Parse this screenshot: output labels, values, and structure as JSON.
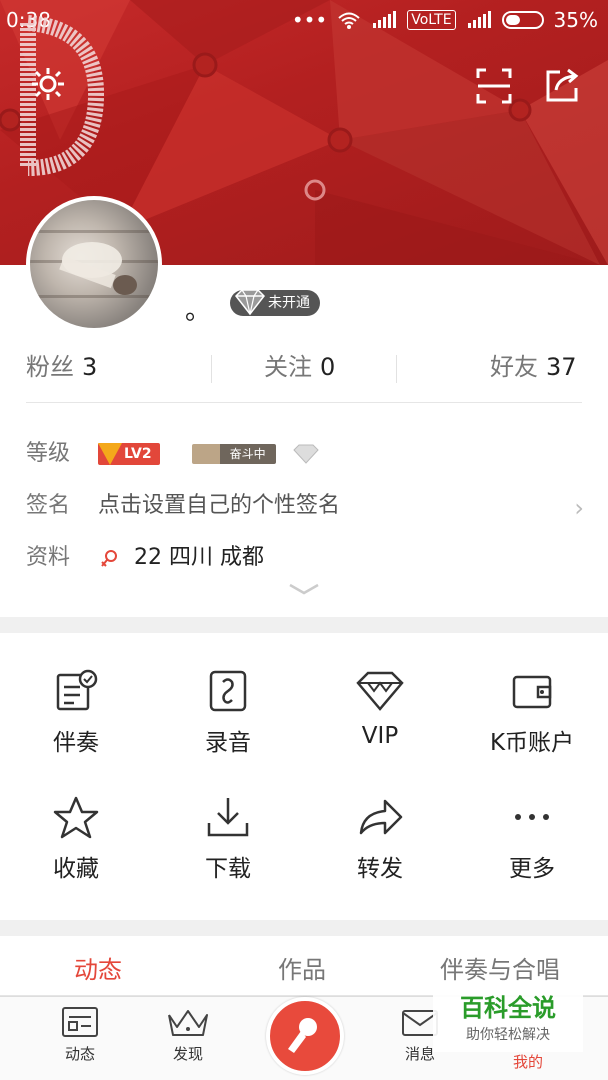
{
  "status_bar": {
    "time": "0:38",
    "network": "VoLTE",
    "battery": "35%"
  },
  "profile": {
    "nickname": "。",
    "vip_status": "未开通",
    "stats": [
      {
        "label": "粉丝",
        "value": "3"
      },
      {
        "label": "关注",
        "value": "0"
      },
      {
        "label": "好友",
        "value": "37"
      }
    ],
    "level_label": "等级",
    "level_badge": "LV2",
    "struggle_badge": "奋斗中",
    "signature_label": "签名",
    "signature_placeholder": "点击设置自己的个性签名",
    "info_label": "资料",
    "info_value": "22  四川 成都"
  },
  "menu": [
    {
      "label": "伴奏",
      "icon": "accompaniment-icon"
    },
    {
      "label": "录音",
      "icon": "record-audio-icon"
    },
    {
      "label": "VIP",
      "icon": "diamond-icon"
    },
    {
      "label": "K币账户",
      "icon": "wallet-icon"
    },
    {
      "label": "收藏",
      "icon": "star-icon"
    },
    {
      "label": "下载",
      "icon": "download-icon"
    },
    {
      "label": "转发",
      "icon": "forward-icon"
    },
    {
      "label": "更多",
      "icon": "more-icon"
    }
  ],
  "tabs": [
    "动态",
    "作品",
    "伴奏与合唱"
  ],
  "bottom_nav": [
    "动态",
    "发现",
    "消息",
    "我的"
  ],
  "watermark": {
    "title": "百科全说",
    "subtitle": "助你轻松解决"
  },
  "colors": {
    "accent": "#e4473a",
    "banner": "#b32020"
  }
}
